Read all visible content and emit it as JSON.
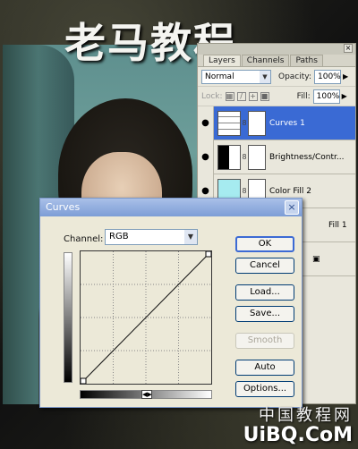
{
  "watermark_title": "老马教程",
  "bottom_watermark": {
    "cn": "中国教程网",
    "en": "UiBQ.CoM"
  },
  "layers_panel": {
    "tabs": [
      "Layers",
      "Channels",
      "Paths"
    ],
    "blend_mode": "Normal",
    "opacity_label": "Opacity:",
    "opacity_value": "100%",
    "lock_label": "Lock:",
    "fill_label": "Fill:",
    "fill_value": "100%",
    "layers": [
      {
        "name": "Curves 1",
        "thumb": "curves",
        "selected": true
      },
      {
        "name": "Brightness/Contr...",
        "thumb": "bc",
        "selected": false
      },
      {
        "name": "Color Fill 2",
        "thumb": "fill",
        "selected": false
      },
      {
        "name": "Fill 1",
        "thumb": "fill",
        "selected": false
      },
      {
        "name": "",
        "thumb": "",
        "selected": false
      }
    ]
  },
  "curves_dialog": {
    "title": "Curves",
    "channel_label": "Channel:",
    "channel_value": "RGB",
    "buttons": {
      "ok": "OK",
      "cancel": "Cancel",
      "load": "Load...",
      "save": "Save...",
      "smooth": "Smooth",
      "auto": "Auto",
      "options": "Options..."
    },
    "curve_points": [
      [
        0,
        0
      ],
      [
        255,
        255
      ]
    ]
  }
}
